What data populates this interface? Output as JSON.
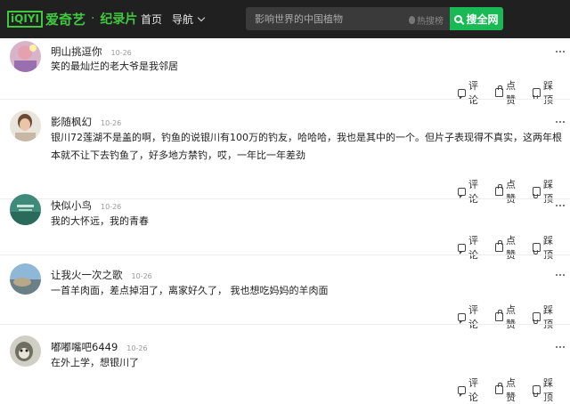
{
  "header": {
    "logo_text": "iQIYI",
    "logo_name": "爱奇艺",
    "logo_dot": "·",
    "section": "纪录片",
    "nav_home": "首页",
    "nav_guide": "导航",
    "search_placeholder": "影响世界的中国植物",
    "hot_label": "热搜榜",
    "search_button": "搜全网"
  },
  "actions": {
    "reply": "评论",
    "like": "点赞",
    "down": "踩顶"
  },
  "comments": [
    {
      "username": "明山挑逗你",
      "date": "10-26",
      "text": "笑的最灿烂的老大爷是我邻居"
    },
    {
      "username": "影随枫幻",
      "date": "10-26",
      "text": "银川72莲湖不是盖的啊，钓鱼的说银川有100万的钓友，哈哈哈，我也是其中的一个。但片子表现得不真实，这两年根本就不让下去钓鱼了，好多地方禁钓，哎，一年比一年差劲"
    },
    {
      "username": "快似小鸟",
      "date": "10-26",
      "text": "我的大怀远，我的青春"
    },
    {
      "username": "让我火一次之歌",
      "date": "10-26",
      "text": "一首羊肉面，差点掉泪了，离家好久了， 我也想吃妈妈的羊肉面"
    },
    {
      "username": "嘟嘟嘴吧6449",
      "date": "10-26",
      "text": "在外上学，想银川了"
    }
  ],
  "colors": {
    "brand_green": "#3fc93f",
    "search_green": "#19b955",
    "topbar_bg": "#202020"
  }
}
